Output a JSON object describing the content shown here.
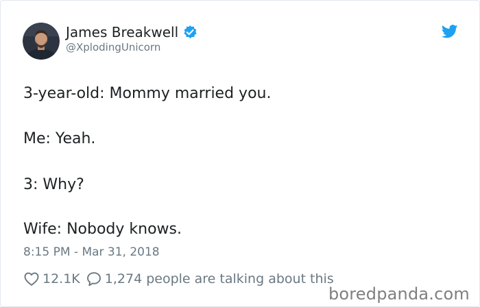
{
  "author": {
    "display_name": "James Breakwell",
    "handle": "@XplodingUnicorn",
    "verified": true
  },
  "tweet": {
    "lines": [
      "3-year-old: Mommy married you.",
      "Me: Yeah.",
      "3: Why?",
      "Wife: Nobody knows."
    ],
    "timestamp": "8:15 PM - Mar 31, 2018"
  },
  "engagement": {
    "likes": "12.1K",
    "conversation": "1,274 people are talking about this"
  },
  "icons": {
    "verified": "verified-badge-icon",
    "brand": "twitter-bird-icon",
    "like": "heart-icon",
    "reply": "speech-bubble-icon"
  },
  "watermark": "boredpanda.com",
  "colors": {
    "twitter_blue": "#1da1f2",
    "text_primary": "#1c2022",
    "text_secondary": "#697882",
    "watermark": "#7f7f7f",
    "border": "#e1e8ed"
  }
}
